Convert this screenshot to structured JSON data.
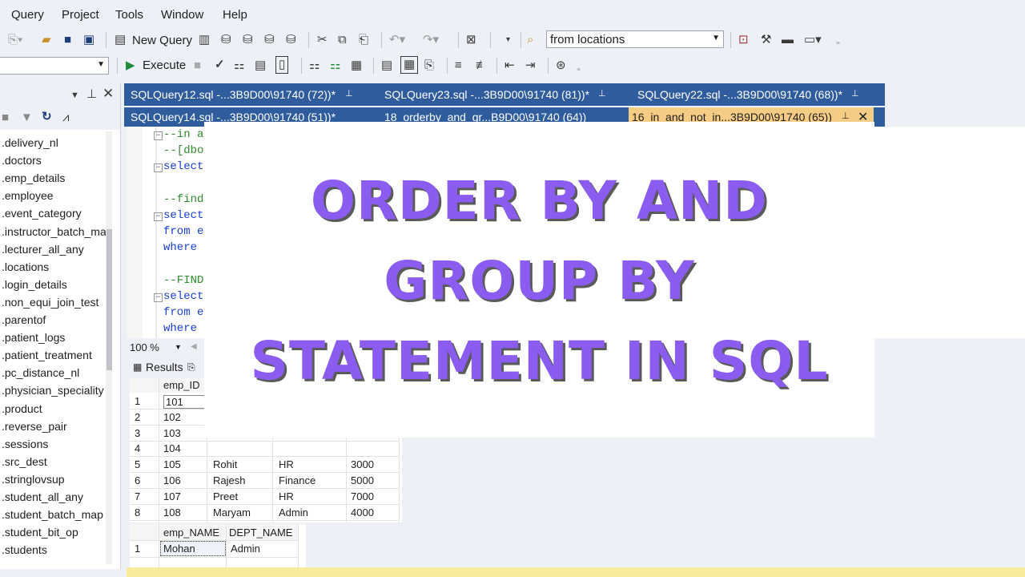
{
  "menu": [
    "Query",
    "Project",
    "Tools",
    "Window",
    "Help"
  ],
  "toolbar": {
    "new_query_label": "New Query",
    "db_combo_value": "from locations",
    "execute_label": "Execute"
  },
  "explorer": {
    "items": [
      ".delivery_nl",
      ".doctors",
      ".emp_details",
      ".employee",
      ".event_category",
      ".instructor_batch_ma",
      ".lecturer_all_any",
      ".locations",
      ".login_details",
      ".non_equi_join_test",
      ".parentof",
      ".patient_logs",
      ".patient_treatment",
      ".pc_distance_nl",
      ".physician_speciality",
      ".product",
      ".reverse_pair",
      ".sessions",
      ".src_dest",
      ".stringlovsup",
      ".student_all_any",
      ".student_batch_map",
      ".student_bit_op",
      ".students"
    ]
  },
  "tabs_row1": [
    "SQLQuery12.sql -...3B9D00\\91740 (72))*",
    "SQLQuery23.sql -...3B9D00\\91740 (81))*",
    "SQLQuery22.sql -...3B9D00\\91740 (68))*"
  ],
  "tabs_row2": [
    "SQLQuery14.sql -...3B9D00\\91740 (51))*",
    "18_orderby_and_gr...B9D00\\91740 (64))",
    "16_in_and_not_in...3B9D00\\91740 (65))"
  ],
  "code_lines": [
    {
      "text": "--in a",
      "cls": "cmt",
      "fold": true
    },
    {
      "text": "--[dbo",
      "cls": "cmt",
      "fold": false
    },
    {
      "text": "select",
      "cls": "kw",
      "fold": true
    },
    {
      "text": "",
      "cls": "",
      "fold": false
    },
    {
      "text": "--find",
      "cls": "cmt",
      "fold": false
    },
    {
      "text": "select",
      "cls": "kw",
      "fold": true
    },
    {
      "text": "from e",
      "cls": "kw",
      "fold": false
    },
    {
      "text": "where",
      "cls": "kw",
      "fold": false
    },
    {
      "text": "",
      "cls": "",
      "fold": false
    },
    {
      "text": "--FIND",
      "cls": "cmt",
      "fold": false
    },
    {
      "text": "select",
      "cls": "kw",
      "fold": true
    },
    {
      "text": "from e",
      "cls": "kw",
      "fold": false
    },
    {
      "text": "where",
      "cls": "kw",
      "fold": false
    }
  ],
  "zoom": "100 %",
  "results_tab": "Results",
  "grid1": {
    "header": "emp_ID",
    "rows": [
      {
        "n": "1",
        "id": "101",
        "name": "",
        "dept": "",
        "sal": ""
      },
      {
        "n": "2",
        "id": "102",
        "name": "",
        "dept": "",
        "sal": ""
      },
      {
        "n": "3",
        "id": "103",
        "name": "",
        "dept": "",
        "sal": ""
      },
      {
        "n": "4",
        "id": "104",
        "name": "",
        "dept": "",
        "sal": ""
      },
      {
        "n": "5",
        "id": "105",
        "name": "Rohit",
        "dept": "HR",
        "sal": "3000"
      },
      {
        "n": "6",
        "id": "106",
        "name": "Rajesh",
        "dept": "Finance",
        "sal": "5000"
      },
      {
        "n": "7",
        "id": "107",
        "name": "Preet",
        "dept": "HR",
        "sal": "7000"
      },
      {
        "n": "8",
        "id": "108",
        "name": "Maryam",
        "dept": "Admin",
        "sal": "4000"
      }
    ]
  },
  "grid2": {
    "headers": [
      "emp_NAME",
      "DEPT_NAME"
    ],
    "row": {
      "n": "1",
      "name": "Mohan",
      "dept": "Admin"
    }
  },
  "overlay": {
    "line1": "ORDER BY AND",
    "line2": "GROUP BY",
    "line3": "STATEMENT IN SQL"
  },
  "colors": {
    "tab_bar": "#2f5c9c",
    "active_tab": "#f5cc84",
    "headline": "#8a5cf0"
  }
}
